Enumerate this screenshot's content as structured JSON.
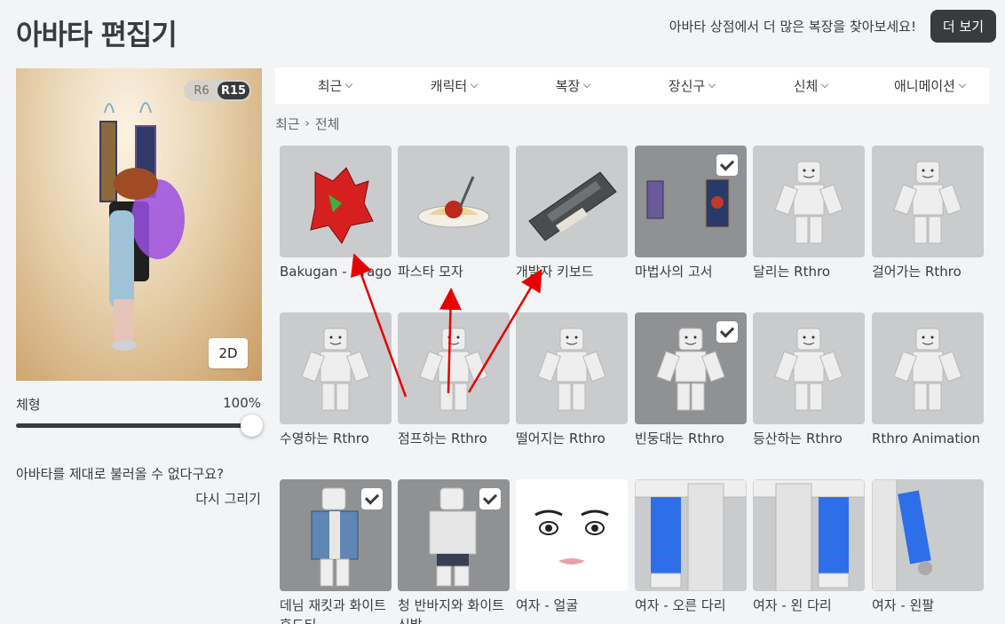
{
  "header": {
    "title": "아바타 편집기",
    "promo": "아바타 상점에서 더 많은 복장을 찾아보세요!",
    "more_button": "더 보기"
  },
  "preview": {
    "rig_options": [
      "R6",
      "R15"
    ],
    "rig_selected": "R15",
    "view_button": "2D"
  },
  "body_scale": {
    "label": "체형",
    "value_text": "100%",
    "value": 1.0
  },
  "help": {
    "question": "아바타를 제대로 불러올 수 없다구요?",
    "link": "다시 그리기"
  },
  "tabs": [
    {
      "label": "최근"
    },
    {
      "label": "캐릭터"
    },
    {
      "label": "복장"
    },
    {
      "label": "장신구"
    },
    {
      "label": "신체"
    },
    {
      "label": "애니메이션"
    }
  ],
  "breadcrumb": {
    "parent": "최근",
    "current": "전체"
  },
  "items": [
    {
      "name": "Bakugan - Drago",
      "icon": "dragon-icon",
      "selected": false
    },
    {
      "name": "파스타 모자",
      "icon": "pasta-hat-icon",
      "selected": false
    },
    {
      "name": "개발자 키보드",
      "icon": "keyboard-icon",
      "selected": false
    },
    {
      "name": "마법사의 고서",
      "icon": "spellbook-icon",
      "selected": true
    },
    {
      "name": "달리는 Rthro",
      "icon": "figure-icon",
      "selected": false
    },
    {
      "name": "걸어가는 Rthro",
      "icon": "figure-icon",
      "selected": false
    },
    {
      "name": "수영하는 Rthro",
      "icon": "figure-icon",
      "selected": false
    },
    {
      "name": "점프하는 Rthro",
      "icon": "figure-icon",
      "selected": false
    },
    {
      "name": "떨어지는 Rthro",
      "icon": "figure-icon",
      "selected": false
    },
    {
      "name": "빈둥대는 Rthro",
      "icon": "figure-icon",
      "selected": true
    },
    {
      "name": "등산하는 Rthro",
      "icon": "figure-icon",
      "selected": false
    },
    {
      "name": "Rthro Animation",
      "icon": "figure-icon",
      "selected": false
    },
    {
      "name": "데님 재킷과 화이트 후드티",
      "icon": "shirt-icon",
      "selected": true
    },
    {
      "name": "청 반바지와 화이트 신발",
      "icon": "pants-icon",
      "selected": true
    },
    {
      "name": "여자 - 얼굴",
      "icon": "face-icon",
      "selected": false
    },
    {
      "name": "여자 - 오른 다리",
      "icon": "leg-icon",
      "selected": false
    },
    {
      "name": "여자 - 왼 다리",
      "icon": "leg-icon",
      "selected": false
    },
    {
      "name": "여자 - 왼팔",
      "icon": "arm-icon",
      "selected": false
    }
  ],
  "colors": {
    "background": "#f2f4f5",
    "text": "#393b3d",
    "tile": "#c9cbcc",
    "tile_selected": "#8f9193",
    "annotation_arrow": "#e60000"
  }
}
